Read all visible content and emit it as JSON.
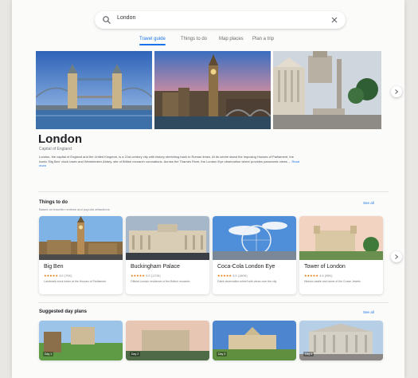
{
  "search": {
    "query": "London"
  },
  "tabs": [
    {
      "label": "Travel guide",
      "active": true
    },
    {
      "label": "Things to do",
      "active": false
    },
    {
      "label": "Map places",
      "active": false
    },
    {
      "label": "Plan a trip",
      "active": false
    }
  ],
  "place": {
    "title": "London",
    "subtitle": "Capital of England",
    "description": "London, the capital of England and the United Kingdom, is a 21st-century city with history stretching back to Roman times. At its centre stand the imposing Houses of Parliament, the iconic 'Big Ben' clock tower and Westminster Abbey, site of British monarch coronations. Across the Thames River, the London Eye observation wheel provides panoramic views ...",
    "more_label": "Read more"
  },
  "things_to_do": {
    "title": "Things to do",
    "subtitle": "Based on traveller reviews and popular attractions",
    "see_all_label": "See all",
    "items": [
      {
        "name": "Big Ben",
        "stars": "★★★★★",
        "count": "4.6 (70K)",
        "desc": "Landmark clock tower at the Houses of Parliament"
      },
      {
        "name": "Buckingham Palace",
        "stars": "★★★★★",
        "count": "4.5 (170K)",
        "desc": "Official London residence of the British monarch"
      },
      {
        "name": "Coca-Cola London Eye",
        "stars": "★★★★★",
        "count": "4.5 (180K)",
        "desc": "Giant observation wheel with views over the city"
      },
      {
        "name": "Tower of London",
        "stars": "★★★★★",
        "count": "4.6 (95K)",
        "desc": "Historic castle and home of the Crown Jewels"
      }
    ]
  },
  "suggested_plans": {
    "title": "Suggested day plans",
    "see_all_label": "See all",
    "items": [
      {
        "tag": "Day 1"
      },
      {
        "tag": "Day 2"
      },
      {
        "tag": "Day 3"
      },
      {
        "tag": "Day 4"
      }
    ]
  },
  "colors": {
    "accent": "#1a73e8",
    "star": "#e37400"
  }
}
